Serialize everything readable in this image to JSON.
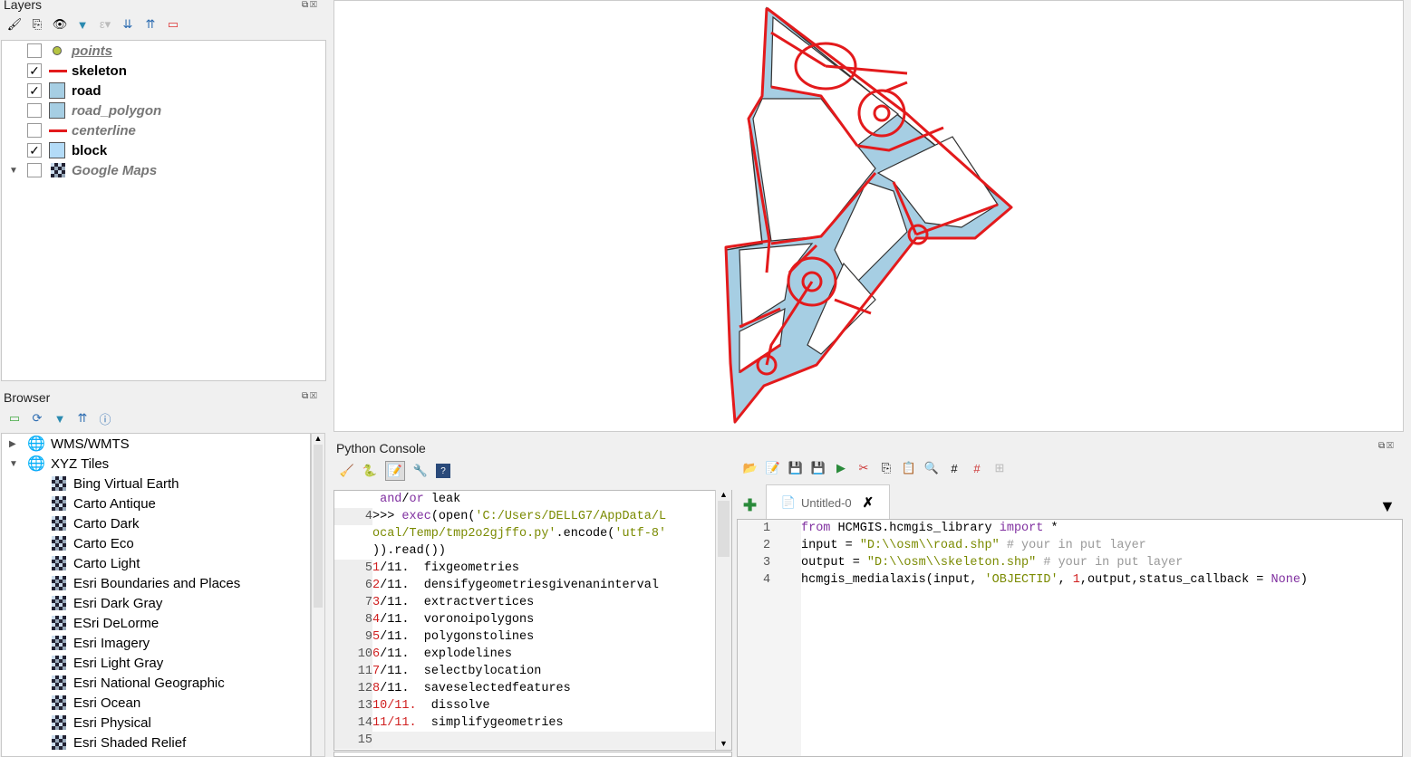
{
  "layers_panel": {
    "title": "Layers",
    "items": [
      {
        "name": "points",
        "checked": false,
        "symbol": "point",
        "color": "#b5c442"
      },
      {
        "name": "skeleton",
        "checked": true,
        "symbol": "line",
        "color": "#e31a1c"
      },
      {
        "name": "road",
        "checked": true,
        "symbol": "fill",
        "color": "#a6cee3"
      },
      {
        "name": "road_polygon",
        "checked": false,
        "symbol": "fill",
        "color": "#a6cee3"
      },
      {
        "name": "centerline",
        "checked": false,
        "symbol": "line",
        "color": "#e31a1c"
      },
      {
        "name": "block",
        "checked": true,
        "symbol": "fill",
        "color": "#b3dbf7"
      },
      {
        "name": "Google Maps",
        "checked": false,
        "symbol": "tiles"
      }
    ]
  },
  "browser_panel": {
    "title": "Browser",
    "items": [
      "WMS/WMTS",
      "XYZ Tiles"
    ],
    "xyz_children": [
      "Bing Virtual Earth",
      "Carto Antique",
      "Carto Dark",
      "Carto Eco",
      "Carto Light",
      "Esri Boundaries and Places",
      "Esri Dark Gray",
      "ESri DeLorme",
      "Esri Imagery",
      "Esri Light Gray",
      "Esri National Geographic",
      "Esri Ocean",
      "Esri Physical",
      "Esri Shaded Relief"
    ]
  },
  "python_console": {
    "title": "Python Console",
    "lines": [
      {
        "n": "",
        "parts": [
          {
            "t": " and",
            "c": "kw"
          },
          {
            "t": "/",
            "c": ""
          },
          {
            "t": "or",
            "c": "kw"
          },
          {
            "t": " leak",
            "c": ""
          }
        ]
      },
      {
        "n": "4",
        "parts": [
          {
            "t": ">>> ",
            "c": ""
          },
          {
            "t": "exec",
            "c": "kw"
          },
          {
            "t": "(open(",
            "c": ""
          },
          {
            "t": "'C:/Users/DELLG7/AppData/L",
            "c": "st"
          }
        ]
      },
      {
        "n": "",
        "parts": [
          {
            "t": "ocal/Temp/tmp2o2gjffo.py'",
            "c": "st"
          },
          {
            "t": ".encode(",
            "c": ""
          },
          {
            "t": "'utf-8'",
            "c": "st"
          }
        ]
      },
      {
        "n": "",
        "parts": [
          {
            "t": ")).read())",
            "c": ""
          }
        ]
      },
      {
        "n": "5",
        "parts": [
          {
            "t": "1",
            "c": "nm"
          },
          {
            "t": "/11.  fixgeometries",
            "c": ""
          }
        ]
      },
      {
        "n": "6",
        "parts": [
          {
            "t": "2",
            "c": "nm"
          },
          {
            "t": "/11.  densifygeometriesgivenaninterval",
            "c": ""
          }
        ]
      },
      {
        "n": "7",
        "parts": [
          {
            "t": "3",
            "c": "nm"
          },
          {
            "t": "/11.  extractvertices",
            "c": ""
          }
        ]
      },
      {
        "n": "8",
        "parts": [
          {
            "t": "4",
            "c": "nm"
          },
          {
            "t": "/11.  voronoipolygons",
            "c": ""
          }
        ]
      },
      {
        "n": "9",
        "parts": [
          {
            "t": "5",
            "c": "nm"
          },
          {
            "t": "/11.  polygonstolines",
            "c": ""
          }
        ]
      },
      {
        "n": "10",
        "parts": [
          {
            "t": "6",
            "c": "nm"
          },
          {
            "t": "/11.  explodelines",
            "c": ""
          }
        ]
      },
      {
        "n": "11",
        "parts": [
          {
            "t": "7",
            "c": "nm"
          },
          {
            "t": "/11.  selectbylocation",
            "c": ""
          }
        ]
      },
      {
        "n": "12",
        "parts": [
          {
            "t": "8",
            "c": "nm"
          },
          {
            "t": "/11.  saveselectedfeatures",
            "c": ""
          }
        ]
      },
      {
        "n": "13",
        "parts": [
          {
            "t": "10/11.",
            "c": "nm"
          },
          {
            "t": "  dissolve",
            "c": ""
          }
        ]
      },
      {
        "n": "14",
        "parts": [
          {
            "t": "11/11.",
            "c": "nm"
          },
          {
            "t": "  simplifygeometries",
            "c": ""
          }
        ]
      },
      {
        "n": "15",
        "parts": []
      }
    ]
  },
  "editor": {
    "tab_label": "Untitled-0",
    "lines": [
      {
        "n": "1",
        "parts": [
          {
            "t": "from",
            "c": "kw"
          },
          {
            "t": " HCMGIS.hcmgis_library ",
            "c": ""
          },
          {
            "t": "import",
            "c": "kw"
          },
          {
            "t": " *",
            "c": ""
          }
        ]
      },
      {
        "n": "2",
        "parts": [
          {
            "t": "input = ",
            "c": ""
          },
          {
            "t": "\"D:\\\\osm\\\\road.shp\"",
            "c": "st"
          },
          {
            "t": " # your in put layer",
            "c": "cm"
          }
        ]
      },
      {
        "n": "3",
        "parts": [
          {
            "t": "output = ",
            "c": ""
          },
          {
            "t": "\"D:\\\\osm\\\\skeleton.shp\"",
            "c": "st"
          },
          {
            "t": " # your in put layer",
            "c": "cm"
          }
        ]
      },
      {
        "n": "4",
        "parts": [
          {
            "t": "hcmgis_medialaxis(input, ",
            "c": ""
          },
          {
            "t": "'OBJECTID'",
            "c": "st"
          },
          {
            "t": ", ",
            "c": ""
          },
          {
            "t": "1",
            "c": "nm"
          },
          {
            "t": ",output,status_callback = ",
            "c": ""
          },
          {
            "t": "None",
            "c": "kw"
          },
          {
            "t": ")",
            "c": ""
          }
        ]
      }
    ]
  }
}
